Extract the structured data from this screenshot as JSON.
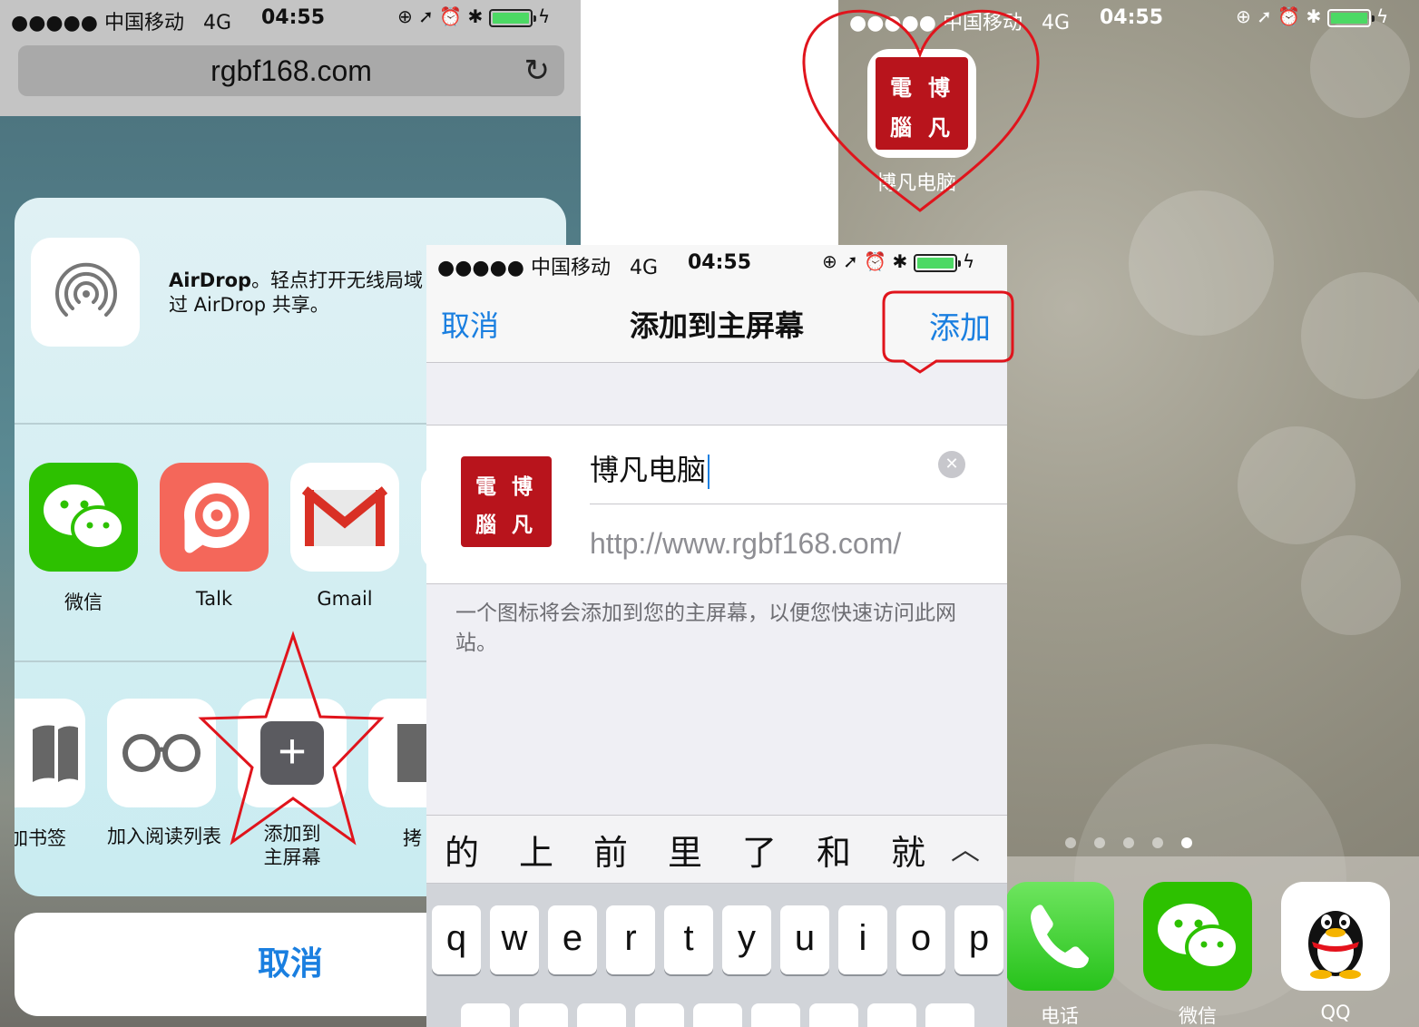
{
  "status_bar": {
    "carrier": "●●●●● 中国移动",
    "network": "4G",
    "time": "04:55"
  },
  "safari": {
    "url": "rgbf168.com",
    "airdrop_title": "AirDrop",
    "airdrop_text_1": "。轻点打开无线局域",
    "airdrop_text_2": "过 AirDrop 共享。",
    "share_apps": [
      "微信",
      "Talk",
      "Gmail"
    ],
    "actions": [
      "加书签",
      "加入阅读列表",
      "添加到",
      "主屏幕",
      "拷"
    ],
    "cancel": "取消"
  },
  "add_to_home": {
    "cancel": "取消",
    "title": "添加到主屏幕",
    "add": "添加",
    "name": "博凡电脑",
    "url": "http://www.rgbf168.com/",
    "description": "一个图标将会添加到您的主屏幕，以便您快速访问此网站。",
    "suggestions": [
      "的",
      "上",
      "前",
      "里",
      "了",
      "和",
      "就"
    ],
    "keys_row1": [
      "q",
      "w",
      "e",
      "r",
      "t",
      "y",
      "u",
      "i",
      "o",
      "p"
    ]
  },
  "home": {
    "icon_label": "博凡电脑",
    "dock": [
      "电话",
      "微信",
      "QQ"
    ],
    "page_count": 5,
    "current_page": 5
  },
  "seal_chars": [
    "電",
    "博",
    "腦",
    "凡"
  ],
  "colors": {
    "ios_blue": "#1a7fe0",
    "seal_red": "#b8141c",
    "annotation_red": "#e0141c",
    "wechat_green": "#2dc100",
    "phone_green": "#4cd964"
  }
}
